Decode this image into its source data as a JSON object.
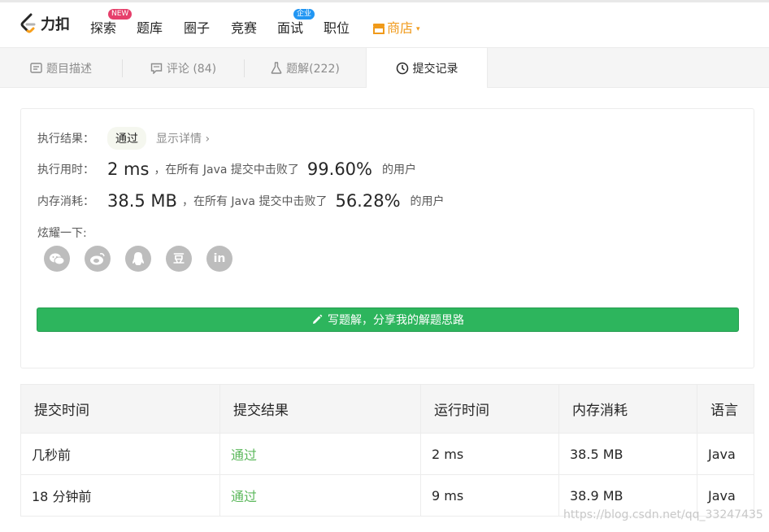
{
  "nav": {
    "logo_text": "力扣",
    "items": [
      {
        "label": "探索",
        "badge": "NEW"
      },
      {
        "label": "题库"
      },
      {
        "label": "圈子"
      },
      {
        "label": "竞赛"
      },
      {
        "label": "面试",
        "badge": "企业"
      },
      {
        "label": "职位"
      }
    ],
    "shop_label": "商店",
    "caret": "▾"
  },
  "tabs": [
    {
      "label": "题目描述",
      "icon": "document-icon"
    },
    {
      "label": "评论 (84)",
      "icon": "comment-icon"
    },
    {
      "label": "题解(222)",
      "icon": "flask-icon"
    },
    {
      "label": "提交记录",
      "icon": "clock-icon"
    }
  ],
  "result": {
    "status_label": "执行结果：",
    "status_value": "通过",
    "detail_link": "显示详情 ›",
    "runtime_label": "执行用时：",
    "runtime_value": "2 ms",
    "runtime_mid": "，在所有 Java 提交中击败了",
    "runtime_pct": "99.60%",
    "runtime_tail": "的用户",
    "memory_label": "内存消耗：",
    "memory_value": "38.5 MB",
    "memory_mid": "，在所有 Java 提交中击败了",
    "memory_pct": "56.28%",
    "memory_tail": "的用户",
    "share_label": "炫耀一下:",
    "share_icons": [
      "wechat-icon",
      "weibo-icon",
      "qq-icon",
      "douban-icon",
      "linkedin-icon"
    ],
    "share_glyph_douban": "豆",
    "share_glyph_linkedin": "in",
    "write_button": "写题解，分享我的解题思路"
  },
  "table": {
    "headers": [
      "提交时间",
      "提交结果",
      "运行时间",
      "内存消耗",
      "语言"
    ],
    "rows": [
      [
        "几秒前",
        "通过",
        "2 ms",
        "38.5 MB",
        "Java"
      ],
      [
        "18 分钟前",
        "通过",
        "9 ms",
        "38.9 MB",
        "Java"
      ]
    ]
  },
  "watermark": "https://blog.csdn.net/qq_33247435",
  "colors": {
    "accent_green": "#2db55d",
    "pass_text": "#5cb85c",
    "shop_orange": "#f09a1a",
    "badge_new": "#e63f6b",
    "badge_enterprise": "#2196f3"
  }
}
